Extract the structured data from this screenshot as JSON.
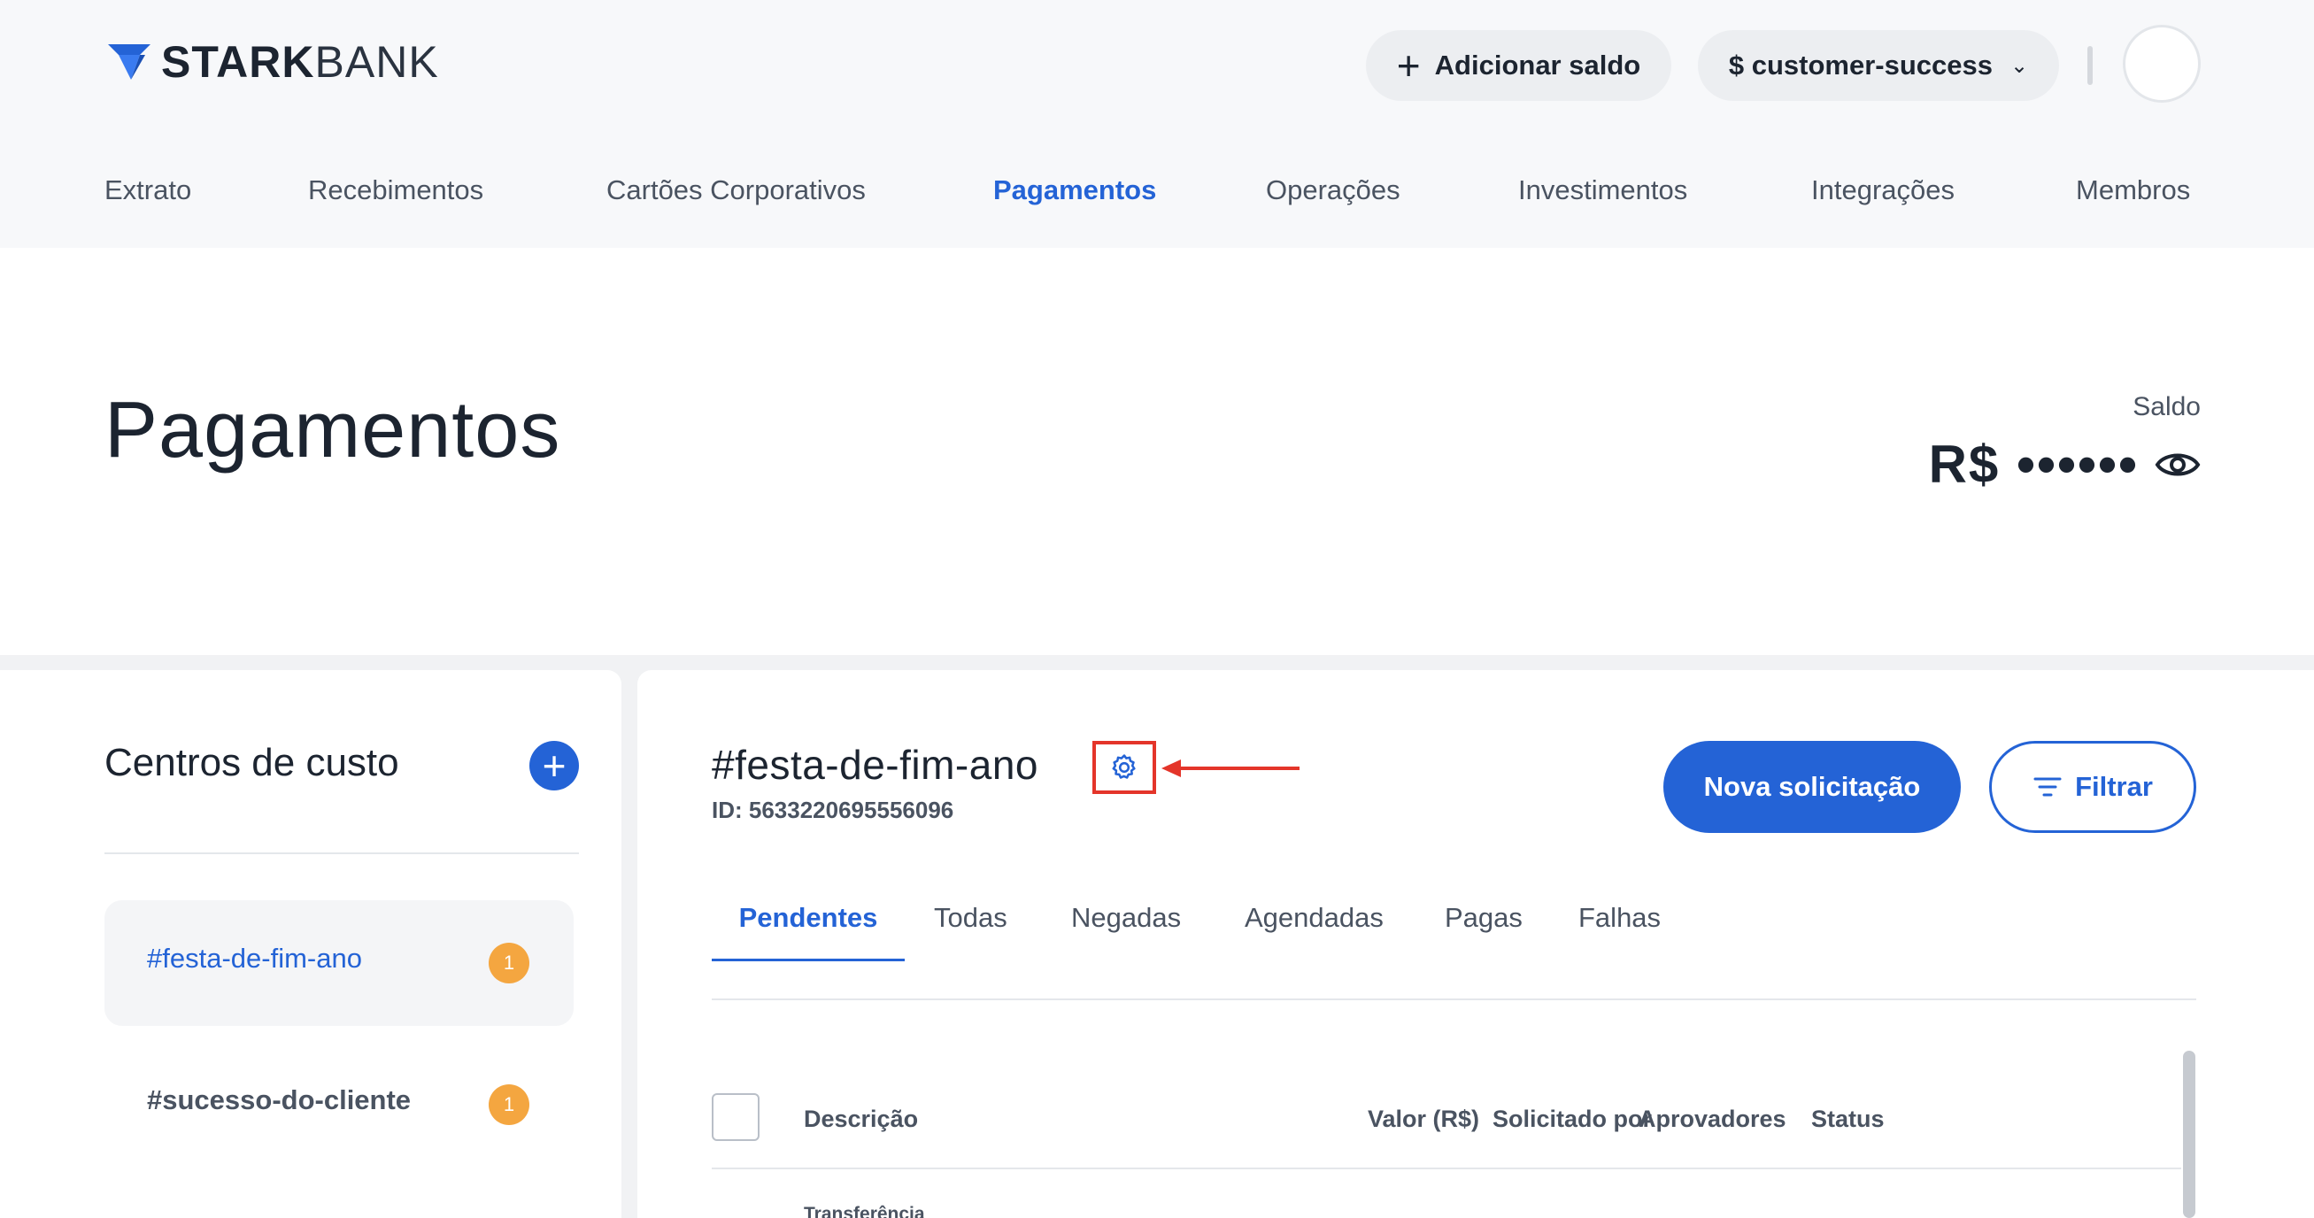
{
  "brand": {
    "part1": "STARK",
    "part2": "BANK"
  },
  "header": {
    "add_balance_label": "Adicionar saldo",
    "add_icon": "plus-icon",
    "workspace_label": "$ customer-success",
    "workspace_icon": "chevron-down-icon"
  },
  "nav": {
    "items": [
      "Extrato",
      "Recebimentos",
      "Cartões Corporativos",
      "Pagamentos",
      "Operações",
      "Investimentos",
      "Integrações",
      "Membros"
    ],
    "active": "Pagamentos"
  },
  "hero": {
    "title": "Pagamentos",
    "balance_label": "Saldo",
    "balance_value": "R$ ••••••",
    "balance_icon": "eye-icon"
  },
  "cost_centers": {
    "title": "Centros de custo",
    "add_icon": "plus-icon",
    "items": [
      {
        "label": "#festa-de-fim-ano",
        "count": "1",
        "active": true
      },
      {
        "label": "#sucesso-do-cliente",
        "count": "1",
        "active": false
      }
    ]
  },
  "detail": {
    "name": "#festa-de-fim-ano",
    "id_text": "ID: 5633220695556096",
    "settings_icon": "gear-icon",
    "new_request_label": "Nova solicitação",
    "filter_label": "Filtrar",
    "filter_icon": "filter-icon",
    "tabs": [
      "Pendentes",
      "Todas",
      "Negadas",
      "Agendadas",
      "Pagas",
      "Falhas"
    ],
    "active_tab": "Pendentes",
    "columns": [
      "Descrição",
      "Valor (R$)",
      "Solicitado por",
      "Aprovadores",
      "Status"
    ],
    "first_row_type": "Transferência"
  },
  "colors": {
    "accent": "#2463d6",
    "badge": "#f4a640",
    "highlight": "#e4352a"
  }
}
